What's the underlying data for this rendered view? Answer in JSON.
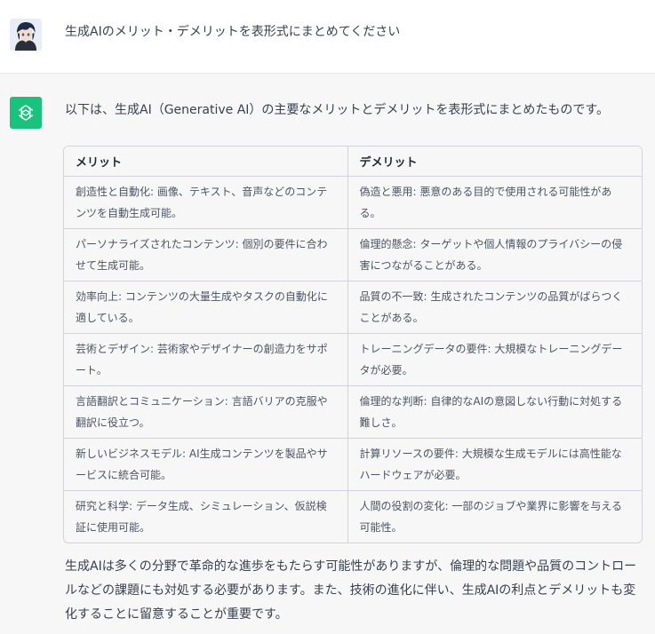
{
  "user": {
    "message": "生成AIのメリット・デメリットを表形式にまとめてください"
  },
  "assistant": {
    "intro": "以下は、生成AI（Generative AI）の主要なメリットとデメリットを表形式にまとめたものです。",
    "table": {
      "headers": [
        "メリット",
        "デメリット"
      ],
      "rows": [
        [
          "創造性と自動化: 画像、テキスト、音声などのコンテンツを自動生成可能。",
          "偽造と悪用: 悪意のある目的で使用される可能性がある。"
        ],
        [
          "パーソナライズされたコンテンツ: 個別の要件に合わせて生成可能。",
          "倫理的懸念: ターゲットや個人情報のプライバシーの侵害につながることがある。"
        ],
        [
          "効率向上: コンテンツの大量生成やタスクの自動化に適している。",
          "品質の不一致: 生成されたコンテンツの品質がばらつくことがある。"
        ],
        [
          "芸術とデザイン: 芸術家やデザイナーの創造力をサポート。",
          "トレーニングデータの要件: 大規模なトレーニングデータが必要。"
        ],
        [
          "言語翻訳とコミュニケーション: 言語バリアの克服や翻訳に役立つ。",
          "倫理的な判断: 自律的なAIの意図しない行動に対処する難しさ。"
        ],
        [
          "新しいビジネスモデル: AI生成コンテンツを製品やサービスに統合可能。",
          "計算リソースの要件: 大規模な生成モデルには高性能なハードウェアが必要。"
        ],
        [
          "研究と科学: データ生成、シミュレーション、仮説検証に使用可能。",
          "人間の役割の変化: 一部のジョブや業界に影響を与える可能性。"
        ]
      ]
    },
    "outro": "生成AIは多くの分野で革命的な進歩をもたらす可能性がありますが、倫理的な問題や品質のコントロールなどの課題にも対処する必要があります。また、技術の進化に伴い、生成AIの利点とデメリットも変化することに留意することが重要です。"
  },
  "colors": {
    "assistant_avatar_bg": "#19c37d",
    "user_row_bg": "#ffffff",
    "assistant_row_bg": "#f7f7f8"
  }
}
